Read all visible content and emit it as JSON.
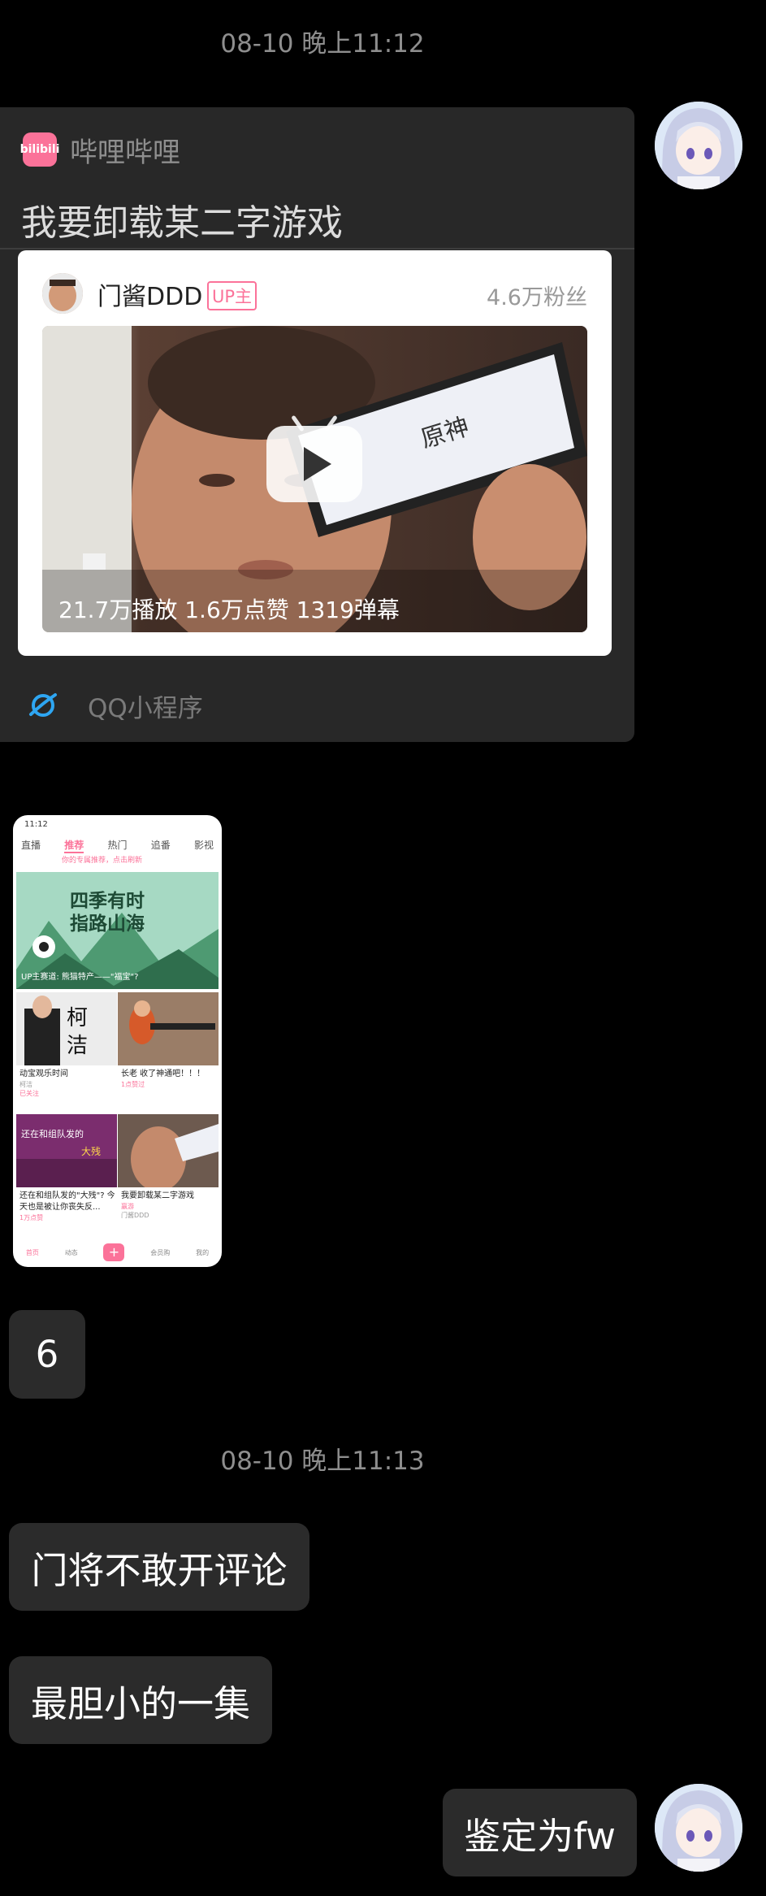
{
  "messages": {
    "timestamp1": "08-10 晚上11:12",
    "timestamp2": "08-10 晚上11:13",
    "share_card": {
      "app_logo_text": "bilibili",
      "app_name": "哔哩哔哩",
      "title": "我要卸载某二字游戏",
      "uploader": "门酱DDD",
      "uploader_badge": "UP主",
      "fans": "4.6万粉丝",
      "stats": "21.7万播放  1.6万点赞  1319弹幕",
      "footer": "QQ小程序"
    },
    "screenshot_thumb": {
      "status_time": "11:12",
      "tabs": [
        "直播",
        "推荐",
        "热门",
        "追番",
        "影视"
      ],
      "active_tab": "推荐",
      "hint": "你的专属推荐，点击刷新",
      "banner_title": "四季有时\n指路山海",
      "banner_sub": "UP主赛道: 熊猫特产——\"福宝\"?",
      "cells": [
        {
          "title": "动宝观乐时间",
          "author": "柯洁",
          "tag": "已关注"
        },
        {
          "title": "长老 收了神通吧！！！",
          "author": "",
          "tag": "1点赞过"
        },
        {
          "title": "还在和组队发的\"大残\"? 今天也是被让你丧失反...",
          "author": "",
          "tag": "1万点赞"
        },
        {
          "title": "我要卸载某二字游戏",
          "author": "门酱DDD",
          "tag": "赢游"
        }
      ],
      "bottom_nav": [
        "首页",
        "动态",
        "+",
        "会员购",
        "我的"
      ]
    },
    "bubble_6": "6",
    "bubble_door": "门将不敢开评论",
    "bubble_timid": "最胆小的一集",
    "bubble_verdict": "鉴定为fw"
  },
  "colors": {
    "background": "#000000",
    "bubble": "#2b2b2b",
    "bili_pink": "#fb7299",
    "qq_blue": "#2ea6f2"
  }
}
